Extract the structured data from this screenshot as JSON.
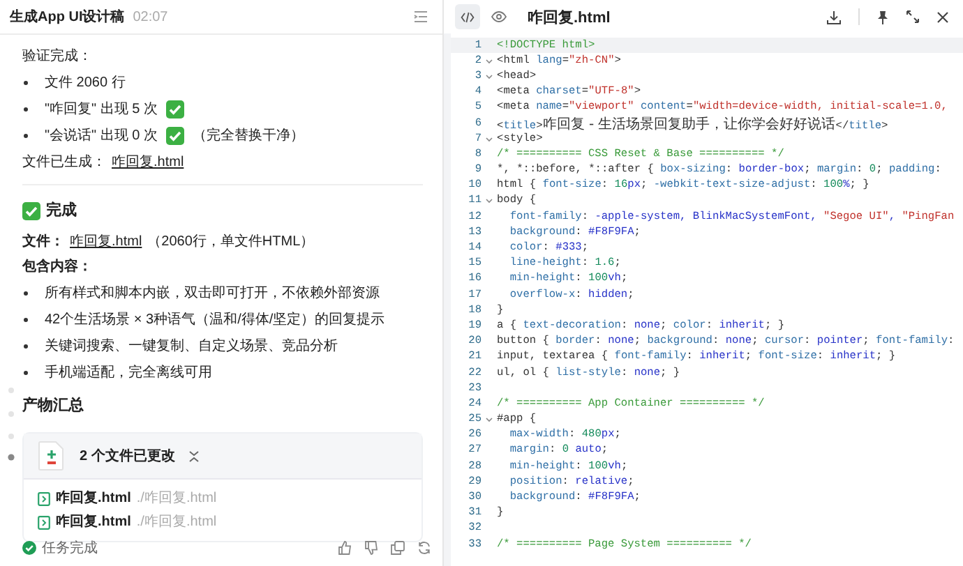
{
  "chat": {
    "title": "生成App UI设计稿",
    "time": "02:07",
    "blocks": [
      {
        "kind": "text",
        "text": "验证完成：",
        "bold": false
      },
      {
        "kind": "bullets",
        "items": [
          {
            "text": "文件 2060 行",
            "check": false
          },
          {
            "text": "\"咋回复\" 出现 5 次",
            "check": true
          },
          {
            "text": "\"会说话\" 出现 0 次",
            "check": true,
            "note": "（完全替换干净）"
          }
        ]
      },
      {
        "kind": "file_line",
        "label": "文件已生成：",
        "label_bold": false,
        "link": "咋回复.html"
      },
      {
        "kind": "divider"
      },
      {
        "kind": "heading",
        "text": "完成",
        "check": true
      },
      {
        "kind": "file_line",
        "label": "文件：",
        "label_bold": true,
        "link": "咋回复.html",
        "suffix": "（2060行，单文件HTML）"
      },
      {
        "kind": "text",
        "text": "包含内容：",
        "bold": true
      },
      {
        "kind": "bullets",
        "items": [
          {
            "text": "所有样式和脚本内嵌，双击即可打开，不依赖外部资源",
            "check": false
          },
          {
            "text": "42个生活场景 × 3种语气（温和/得体/坚定）的回复提示",
            "check": false
          },
          {
            "text": "关键词搜索、一键复制、自定义场景、竞品分析",
            "check": false
          },
          {
            "text": "手机端适配，完全离线可用",
            "check": false
          }
        ]
      },
      {
        "kind": "heading",
        "text": "产物汇总",
        "check": false
      },
      {
        "kind": "files_card",
        "summary": "2 个文件已更改",
        "files": [
          {
            "name": "咋回复.html",
            "path": "./咋回复.html"
          },
          {
            "name": "咋回复.html",
            "path": "./咋回复.html"
          }
        ]
      }
    ],
    "status": "任务完成"
  },
  "editor": {
    "filename": "咋回复.html",
    "view_tabs": [
      {
        "kind": "code",
        "selected": true
      },
      {
        "kind": "preview",
        "selected": false
      }
    ],
    "lines": [
      {
        "n": "1",
        "fold": false,
        "active": true,
        "text": "<!DOCTYPE html>"
      },
      {
        "n": "2",
        "fold": true,
        "active": false,
        "text": "<html lang=\"zh-CN\">"
      },
      {
        "n": "3",
        "fold": true,
        "active": false,
        "text": "<head>"
      },
      {
        "n": "4",
        "fold": false,
        "active": false,
        "text": "<meta charset=\"UTF-8\">"
      },
      {
        "n": "5",
        "fold": false,
        "active": false,
        "text": "<meta name=\"viewport\" content=\"width=device-width, initial-scale=1.0,"
      },
      {
        "n": "6",
        "fold": false,
        "active": false,
        "text": "<title>咋回复 - 生活场景回复助手，让你学会好好说话</title>"
      },
      {
        "n": "7",
        "fold": true,
        "active": false,
        "text": "<style>"
      },
      {
        "n": "8",
        "fold": false,
        "active": false,
        "text": "/* ========== CSS Reset & Base ========== */"
      },
      {
        "n": "9",
        "fold": false,
        "active": false,
        "text": "*, *::before, *::after { box-sizing: border-box; margin: 0; padding:"
      },
      {
        "n": "10",
        "fold": false,
        "active": false,
        "text": "html { font-size: 16px; -webkit-text-size-adjust: 100%; }"
      },
      {
        "n": "11",
        "fold": true,
        "active": false,
        "text": "body {"
      },
      {
        "n": "12",
        "fold": false,
        "active": false,
        "text": "  font-family: -apple-system, BlinkMacSystemFont, \"Segoe UI\", \"PingFan"
      },
      {
        "n": "13",
        "fold": false,
        "active": false,
        "text": "  background: #F8F9FA;"
      },
      {
        "n": "14",
        "fold": false,
        "active": false,
        "text": "  color: #333;"
      },
      {
        "n": "15",
        "fold": false,
        "active": false,
        "text": "  line-height: 1.6;"
      },
      {
        "n": "16",
        "fold": false,
        "active": false,
        "text": "  min-height: 100vh;"
      },
      {
        "n": "17",
        "fold": false,
        "active": false,
        "text": "  overflow-x: hidden;"
      },
      {
        "n": "18",
        "fold": false,
        "active": false,
        "text": "}"
      },
      {
        "n": "19",
        "fold": false,
        "active": false,
        "text": "a { text-decoration: none; color: inherit; }"
      },
      {
        "n": "20",
        "fold": false,
        "active": false,
        "text": "button { border: none; background: none; cursor: pointer; font-family:"
      },
      {
        "n": "21",
        "fold": false,
        "active": false,
        "text": "input, textarea { font-family: inherit; font-size: inherit; }"
      },
      {
        "n": "22",
        "fold": false,
        "active": false,
        "text": "ul, ol { list-style: none; }"
      },
      {
        "n": "23",
        "fold": false,
        "active": false
      },
      {
        "n": "24",
        "fold": false,
        "active": false,
        "text": "/* ========== App Container ========== */"
      },
      {
        "n": "25",
        "fold": true,
        "active": false,
        "text": "#app {"
      },
      {
        "n": "26",
        "fold": false,
        "active": false,
        "text": "  max-width: 480px;"
      },
      {
        "n": "27",
        "fold": false,
        "active": false,
        "text": "  margin: 0 auto;"
      },
      {
        "n": "28",
        "fold": false,
        "active": false,
        "text": "  min-height: 100vh;"
      },
      {
        "n": "29",
        "fold": false,
        "active": false,
        "text": "  position: relative;"
      },
      {
        "n": "30",
        "fold": false,
        "active": false,
        "text": "  background: #F8F9FA;"
      },
      {
        "n": "31",
        "fold": false,
        "active": false,
        "text": "}"
      },
      {
        "n": "32",
        "fold": false,
        "active": false
      },
      {
        "n": "33",
        "fold": false,
        "active": false,
        "text": "/* ========== Page System ========== */"
      }
    ]
  }
}
